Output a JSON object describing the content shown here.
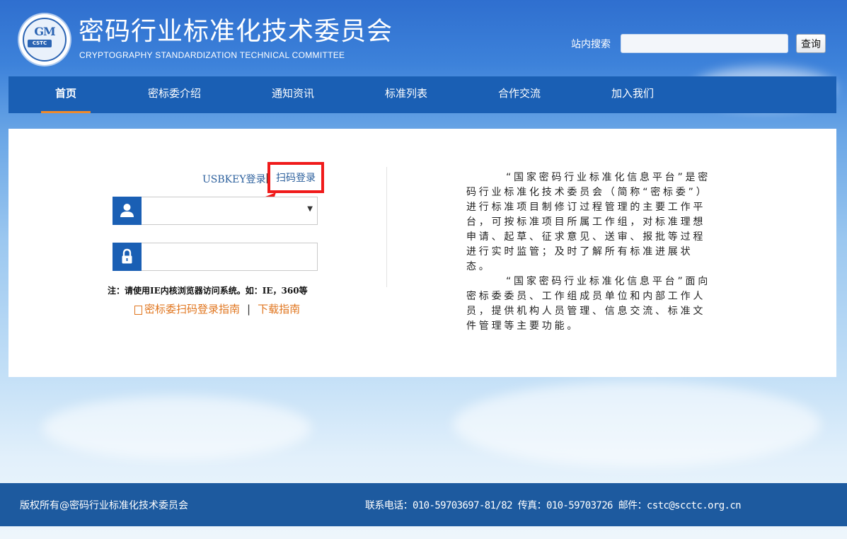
{
  "header": {
    "logo": {
      "top_text": "GM",
      "badge_text": "CSTC",
      "ring_text": "密码行业标准化技术委员会"
    },
    "title": "密码行业标准化技术委员会",
    "subtitle": "CRYPTOGRAPHY STANDARDIZATION TECHNICAL COMMITTEE",
    "search": {
      "label": "站内搜索",
      "value": "",
      "button": "查询"
    }
  },
  "nav": {
    "items": [
      {
        "label": "首页",
        "active": true
      },
      {
        "label": "密标委介绍"
      },
      {
        "label": "通知资讯"
      },
      {
        "label": "标准列表"
      },
      {
        "label": "合作交流"
      },
      {
        "label": "加入我们"
      }
    ]
  },
  "login": {
    "tab_usbkey": "USBKEY登录",
    "tab_sep": "|",
    "tab_qr": "扫码登录",
    "username": {
      "icon": "user-icon",
      "value": ""
    },
    "password": {
      "icon": "lock-icon",
      "value": ""
    },
    "note": "注：请使用IE内核浏览器访问系统。如：IE，360等",
    "guide_link": "密标委扫码登录指南",
    "links_sep": "|",
    "download_link": "下载指南"
  },
  "description": {
    "p1": "“国家密码行业标准化信息平台”是密码行业标准化技术委员会（简称“密标委”）进行标准项目制修订过程管理的主要工作平台，可按标准项目所属工作组，对标准理想申请、起草、征求意见、送审、报批等过程进行实时监管；及时了解所有标准进展状态。",
    "p2": "“国家密码行业标准化信息平台”面向密标委委员、工作组成员单位和内部工作人员，提供机构人员管理、信息交流、标准文件管理等主要功能。"
  },
  "footer": {
    "copyright": "版权所有@密码行业标准化技术委员会",
    "contact": "联系电话：010-59703697-81/82 传真：010-59703726 邮件：cstc@scctc.org.cn"
  },
  "colors": {
    "nav_bg": "#1a5fb4",
    "active_underline": "#f08a2b",
    "highlight_box": "#f01b1b",
    "link_orange": "#e0751e",
    "footer_bg": "#1d5a9f"
  }
}
